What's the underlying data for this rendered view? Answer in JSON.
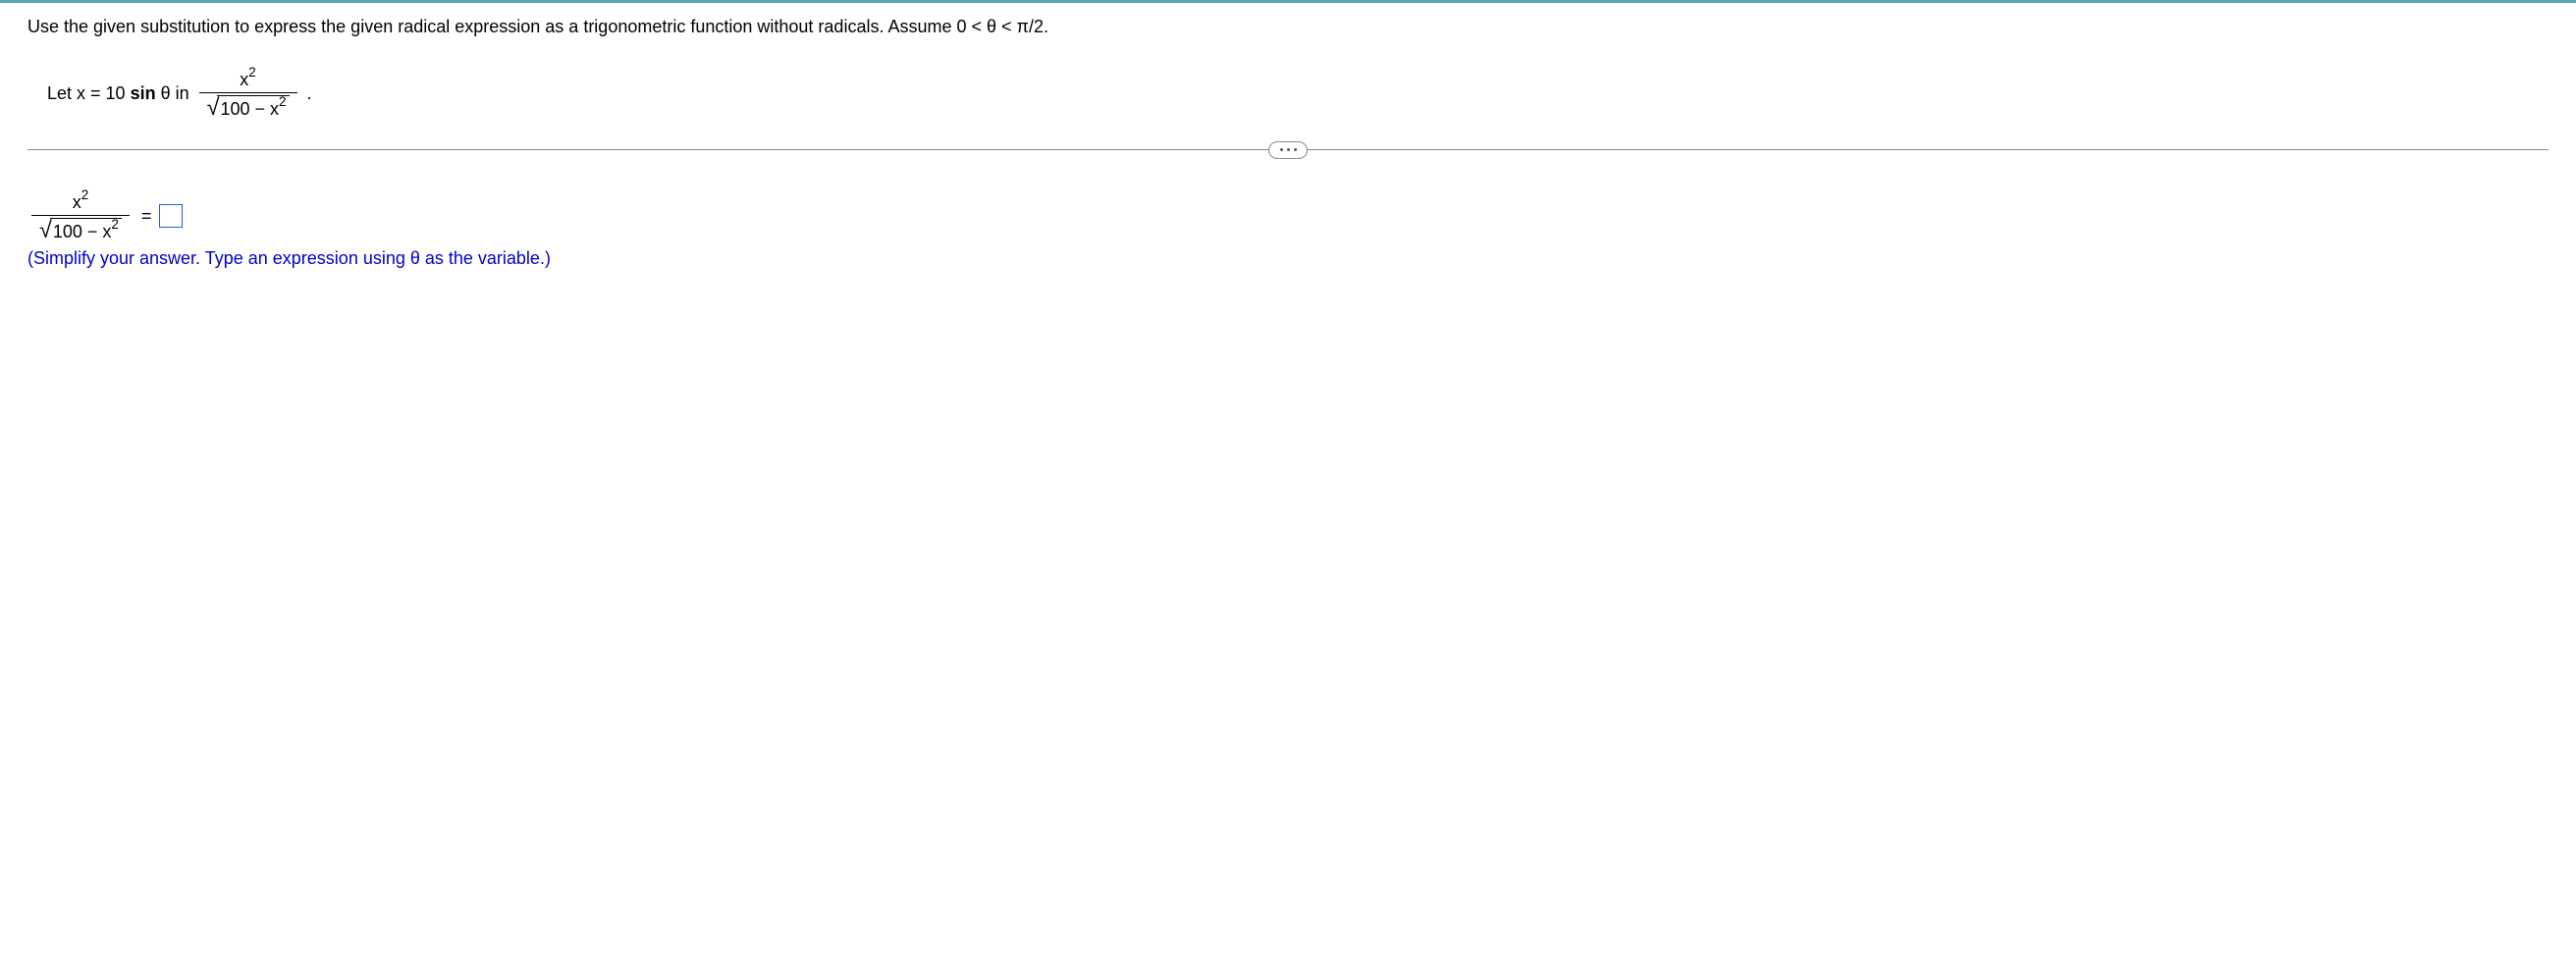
{
  "instruction": "Use the given substitution to express the given radical expression as a trigonometric function without radicals. Assume 0 < θ < π/2.",
  "problem": {
    "prefix": "Let x = 10 ",
    "sin": "sin",
    "theta_in": " θ in ",
    "numerator_base": "x",
    "numerator_exp": "2",
    "radicand_a": "100 − x",
    "radicand_exp": "2",
    "period": "."
  },
  "answer": {
    "numerator_base": "x",
    "numerator_exp": "2",
    "radicand_a": "100 − x",
    "radicand_exp": "2",
    "equals": "="
  },
  "hint": "(Simplify your answer. Type an expression using θ as the variable.)"
}
